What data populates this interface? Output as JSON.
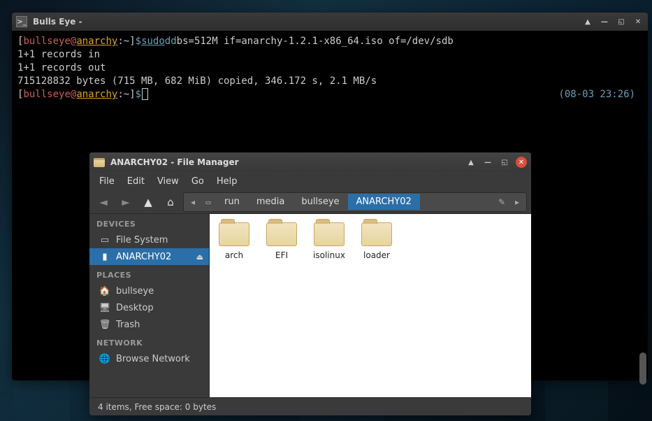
{
  "terminal": {
    "title": "Bulls Eye -",
    "user": "bullseye",
    "host": "anarchy",
    "path": "~",
    "sudo": "sudo",
    "dd": "dd",
    "cmd_args": "bs=512M if=anarchy-1.2.1-x86_64.iso of=/dev/sdb",
    "out1": "1+1 records in",
    "out2": "1+1 records out",
    "out3": "715128832 bytes (715 MB, 682 MiB) copied, 346.172 s, 2.1 MB/s",
    "timestamp": "(08-03 23:26)"
  },
  "filemgr": {
    "title": "ANARCHY02 - File Manager",
    "menu": {
      "file": "File",
      "edit": "Edit",
      "view": "View",
      "go": "Go",
      "help": "Help"
    },
    "path": {
      "seg1": "run",
      "seg2": "media",
      "seg3": "bullseye",
      "seg4": "ANARCHY02"
    },
    "sidebar": {
      "devices_hdr": "DEVICES",
      "filesystem": "File System",
      "anarchy": "ANARCHY02",
      "places_hdr": "PLACES",
      "home": "bullseye",
      "desktop": "Desktop",
      "trash": "Trash",
      "network_hdr": "NETWORK",
      "browse": "Browse Network"
    },
    "folders": {
      "f1": "arch",
      "f2": "EFI",
      "f3": "isolinux",
      "f4": "loader"
    },
    "status": "4 items, Free space: 0 bytes"
  }
}
